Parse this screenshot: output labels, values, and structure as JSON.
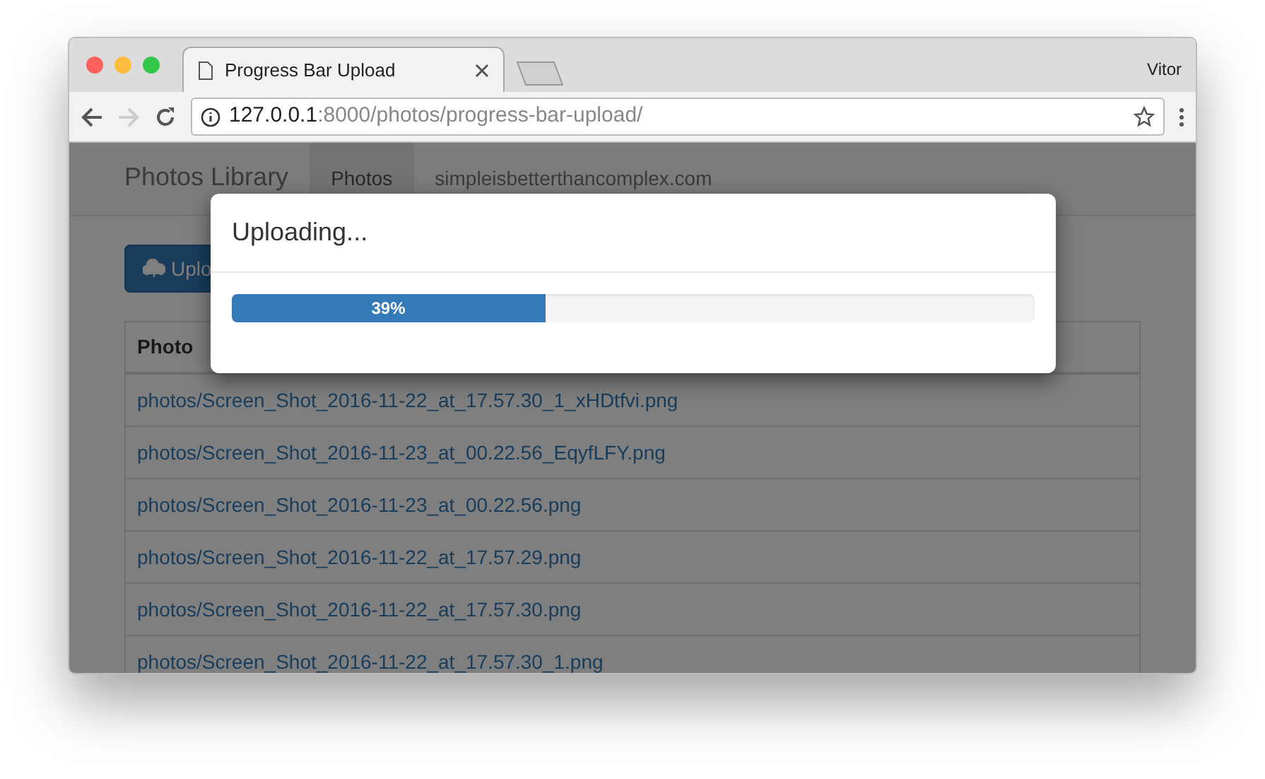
{
  "browser": {
    "tab_title": "Progress Bar Upload",
    "user": "Vitor",
    "url_host": "127.0.0.1",
    "url_path": ":8000/photos/progress-bar-upload/"
  },
  "navbar": {
    "brand": "Photos Library",
    "items": [
      {
        "label": "Photos",
        "selected": true
      },
      {
        "label": "simpleisbetterthancomplex.com",
        "selected": false
      }
    ]
  },
  "upload_button": "Uplo",
  "table": {
    "columns": [
      "Photo"
    ],
    "rows": [
      "photos/Screen_Shot_2016-11-22_at_17.57.30_1_xHDtfvi.png",
      "photos/Screen_Shot_2016-11-23_at_00.22.56_EqyfLFY.png",
      "photos/Screen_Shot_2016-11-23_at_00.22.56.png",
      "photos/Screen_Shot_2016-11-22_at_17.57.29.png",
      "photos/Screen_Shot_2016-11-22_at_17.57.30.png",
      "photos/Screen_Shot_2016-11-22_at_17.57.30_1.png"
    ]
  },
  "modal": {
    "title": "Uploading...",
    "progress": {
      "level": 0.39,
      "label": "39%"
    }
  }
}
